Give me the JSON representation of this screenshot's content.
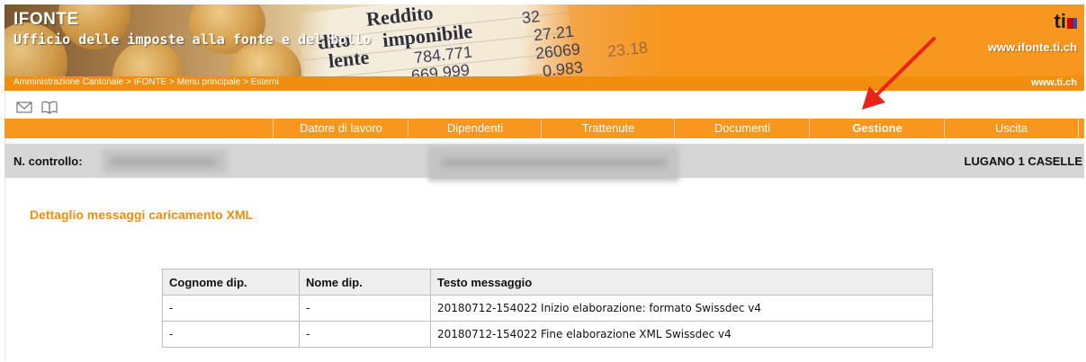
{
  "header": {
    "brand": "IFONTE",
    "office_name": "Ufficio delle imposte alla fonte e del bollo",
    "site_url": "www.ifonte.ti.ch",
    "logo_text": "ti",
    "banner_words": {
      "w1": "Reddito",
      "w2": "imponibile",
      "w3": "dito",
      "w4": "lente",
      "n1": "784.771",
      "n2": "669.999",
      "n3": "32",
      "n4": "27.21",
      "n5": "26069",
      "n6": "0.983",
      "n7": "23.18"
    }
  },
  "breadcrumb": {
    "path": "Amministrazione Cantonale > IFONTE > Menu principale > Esterni",
    "right_link": "www.ti.ch"
  },
  "toolbar": {
    "mail_icon": "envelope-icon",
    "help_icon": "book-icon"
  },
  "menu": {
    "items": [
      {
        "label": "Datore di lavoro",
        "active": false
      },
      {
        "label": "Dipendenti",
        "active": false
      },
      {
        "label": "Trattenute",
        "active": false
      },
      {
        "label": "Documenti",
        "active": false
      },
      {
        "label": "Gestione",
        "active": true
      },
      {
        "label": "Uscita",
        "active": false
      }
    ]
  },
  "control": {
    "label": "N. controllo:",
    "location": "LUGANO 1 CASELLE"
  },
  "page": {
    "title": "Dettaglio messaggi caricamento XML"
  },
  "table": {
    "headers": [
      "Cognome dip.",
      "Nome dip.",
      "Testo messaggio"
    ],
    "rows": [
      [
        "-",
        "-",
        "20180712-154022 Inizio elaborazione: formato Swissdec v4"
      ],
      [
        "-",
        "-",
        "20180712-154022 Fine elaborazione XML Swissdec v4"
      ]
    ]
  },
  "colors": {
    "orange": "#f7971e",
    "orange_dark": "#f28e0d",
    "annotation_arrow": "#e8231a"
  }
}
